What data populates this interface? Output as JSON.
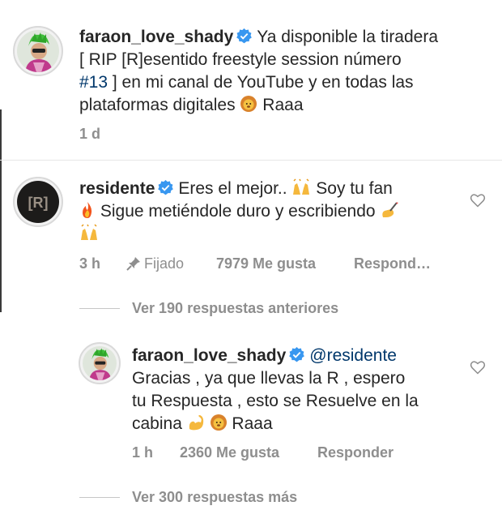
{
  "comments": [
    {
      "username": "faraon_love_shady",
      "text_line1": "Ya disponible la tiradera",
      "text_line2": "[ RIP [R]esentido freestyle session número",
      "hashtag": "#13",
      "text_line3_rest": "] en mi canal de YouTube y en todas las",
      "text_line4": "plataformas digitales",
      "text_end": "Raaa",
      "time": "1 d",
      "verified": true
    },
    {
      "username": "residente",
      "text_line1": "Eres el mejor..",
      "text_line1b": "Soy tu fan",
      "text_line2": "Sigue metiéndole duro  y escribiendo",
      "time": "3 h",
      "pinned": "Fijado",
      "likes": "7979 Me gusta",
      "reply": "Respond…",
      "verified": true
    }
  ],
  "view_previous": "Ver 190 respuestas anteriores",
  "reply": {
    "username": "faraon_love_shady",
    "mention": "@residente",
    "line1": "Gracias , ya que llevas la R , espero",
    "line2": "tu Respuesta , esto se Resuelve en la",
    "line3": "cabina",
    "line3_end": "Raaa",
    "time": "1 h",
    "likes": "2360 Me gusta",
    "reply_label": "Responder"
  },
  "view_more": "Ver 300 respuestas más",
  "icons": {
    "verified": "verified-badge-icon",
    "heart": "heart-outline-icon",
    "pin": "pin-icon",
    "lion": "lion-face-emoji",
    "raised_hands": "raised-hands-emoji",
    "fire": "fire-emoji",
    "writing_hand": "writing-hand-emoji",
    "flexed_biceps": "flexed-biceps-emoji"
  },
  "colors": {
    "verified_blue": "#3897f0",
    "link": "#00376b",
    "meta_gray": "#8e8e8e"
  }
}
